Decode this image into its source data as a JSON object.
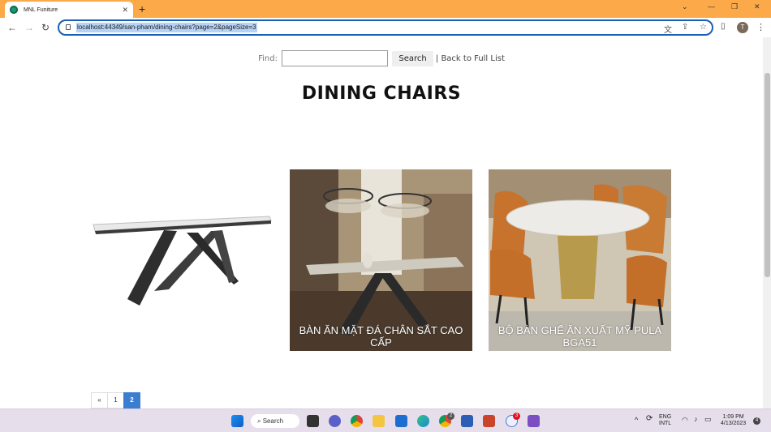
{
  "browser": {
    "tab_title": "MNL Funiture",
    "url": "localhost:44349/san-pham/dining-chairs?page=2&pageSize=3",
    "profile_initial": "T"
  },
  "search": {
    "label": "Find:",
    "placeholder": "",
    "button": "Search",
    "back_link": "| Back to Full List"
  },
  "page": {
    "title": "DINING CHAIRS"
  },
  "products": [
    {
      "caption": ""
    },
    {
      "caption": "BÀN ĂN MẶT ĐÁ CHÂN SẮT CAO CẤP"
    },
    {
      "caption": "BỘ BÀN GHẾ ĂN XUẤT MỸ PULA BGA51"
    }
  ],
  "pagination": {
    "prev": "«",
    "pages": [
      "1",
      "2"
    ],
    "current": "2"
  },
  "taskbar": {
    "search_label": "Search",
    "lang_line1": "ENG",
    "lang_line2": "INTL",
    "time": "1:09 PM",
    "date": "4/13/2023",
    "notification_count": "4",
    "chrome_badge": "2",
    "teams_badge": "3"
  },
  "colors": {
    "tab_strip": "#fca94a",
    "omnibox_border": "#1a5fb4",
    "pager_active": "#3b7ed0",
    "taskbar": "#e6dfeb"
  }
}
